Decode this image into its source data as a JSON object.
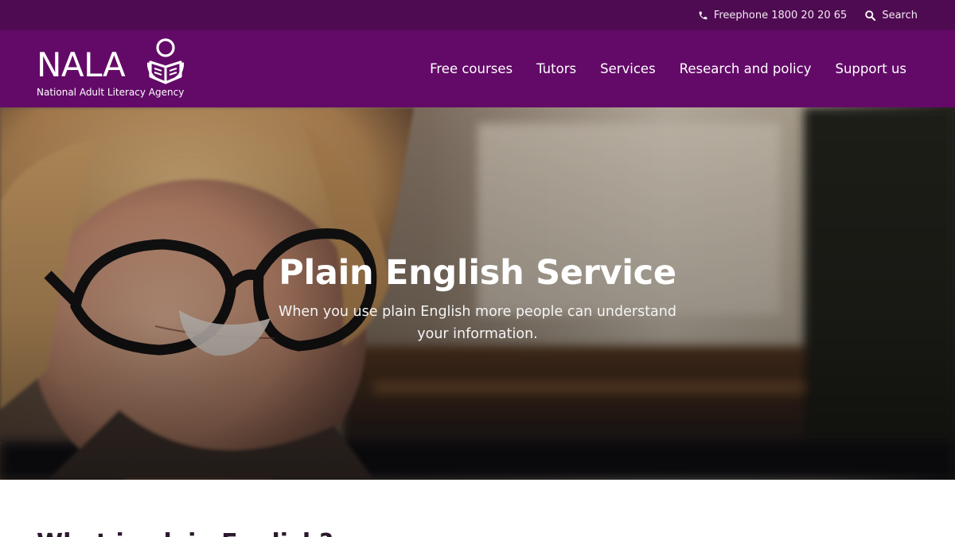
{
  "utility_bar": {
    "phone_label": "Freephone 1800 20 20 65",
    "search_label": "Search"
  },
  "header": {
    "logo_word": "NALA",
    "logo_tagline": "National Adult Literacy Agency",
    "nav": [
      {
        "label": "Free courses"
      },
      {
        "label": "Tutors"
      },
      {
        "label": "Services"
      },
      {
        "label": "Research and policy"
      },
      {
        "label": "Support us"
      }
    ]
  },
  "hero": {
    "title": "Plain English Service",
    "subtitle": "When you use plain English more people can understand your information."
  },
  "content": {
    "heading": "What is plain English?"
  },
  "colors": {
    "utility_bar": "#4f0b52",
    "header": "#630a68",
    "text_on_dark": "#ffffff"
  },
  "icons": {
    "phone": "phone-icon",
    "search": "search-icon",
    "logo_mark": "reader-with-book-icon"
  }
}
